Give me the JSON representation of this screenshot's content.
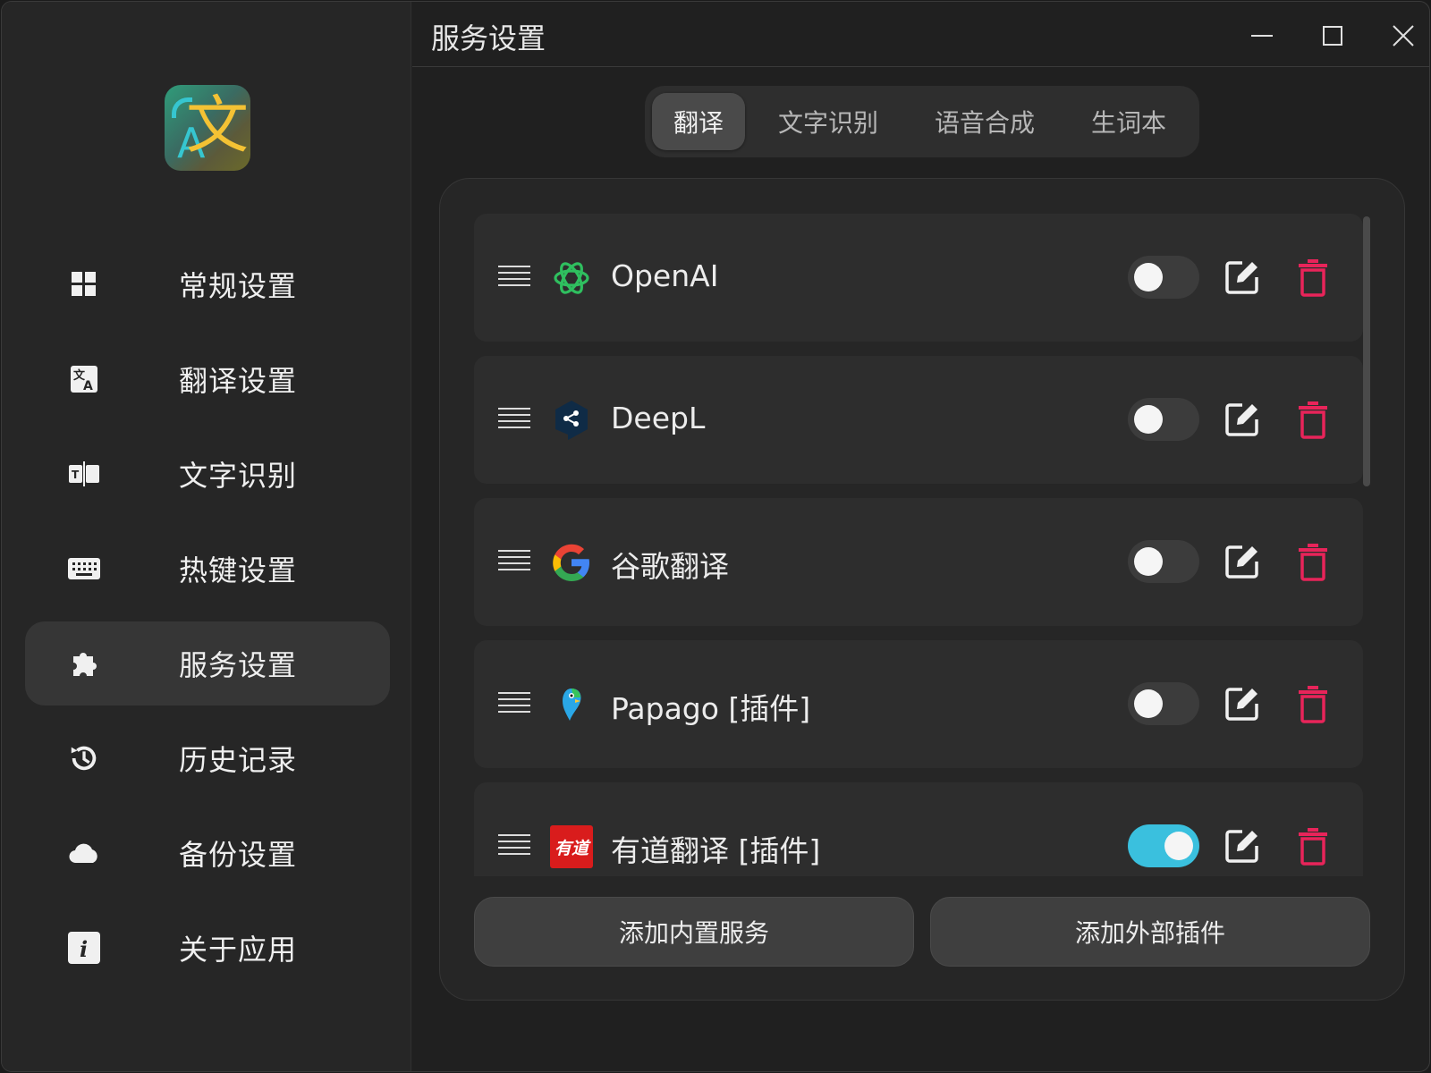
{
  "app": {
    "logo_text": "文",
    "logo_sub": "A"
  },
  "sidebar": {
    "items": [
      {
        "label": "常规设置",
        "icon": "grid-icon"
      },
      {
        "label": "翻译设置",
        "icon": "translate-icon"
      },
      {
        "label": "文字识别",
        "icon": "ocr-icon"
      },
      {
        "label": "热键设置",
        "icon": "keyboard-icon"
      },
      {
        "label": "服务设置",
        "icon": "puzzle-icon",
        "active": true
      },
      {
        "label": "历史记录",
        "icon": "history-icon"
      },
      {
        "label": "备份设置",
        "icon": "cloud-icon"
      },
      {
        "label": "关于应用",
        "icon": "info-icon"
      }
    ]
  },
  "header": {
    "title": "服务设置"
  },
  "tabs": [
    {
      "label": "翻译",
      "active": true
    },
    {
      "label": "文字识别"
    },
    {
      "label": "语音合成"
    },
    {
      "label": "生词本"
    }
  ],
  "services": [
    {
      "name": "OpenAI",
      "icon": "openai-icon",
      "enabled": false
    },
    {
      "name": "DeepL",
      "icon": "deepl-icon",
      "enabled": false
    },
    {
      "name": "谷歌翻译",
      "icon": "google-icon",
      "enabled": false
    },
    {
      "name": "Papago [插件]",
      "icon": "papago-icon",
      "enabled": false
    },
    {
      "name": "有道翻译 [插件]",
      "icon": "youdao-icon",
      "icon_text": "有道",
      "enabled": true
    }
  ],
  "buttons": {
    "add_builtin": "添加内置服务",
    "add_plugin": "添加外部插件"
  },
  "colors": {
    "accent": "#3ac0de",
    "danger": "#e8245a",
    "background": "#202020"
  }
}
